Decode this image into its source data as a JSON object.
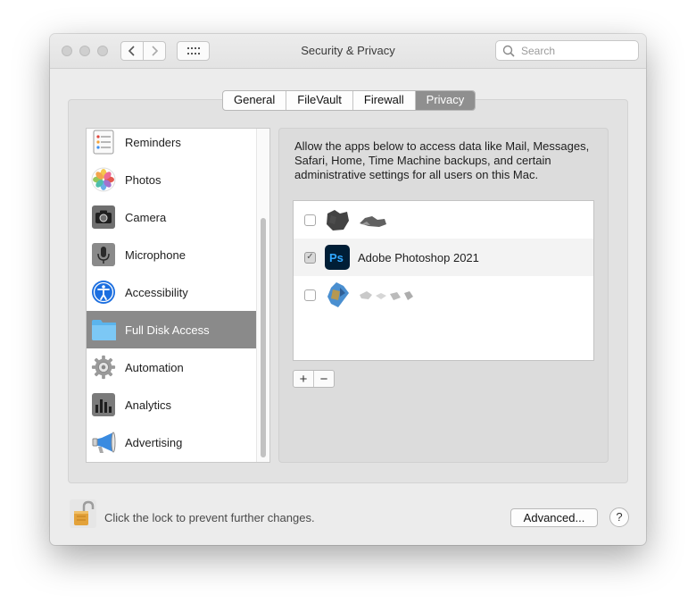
{
  "window": {
    "title": "Security & Privacy"
  },
  "search": {
    "placeholder": "Search"
  },
  "tabs": [
    {
      "label": "General"
    },
    {
      "label": "FileVault"
    },
    {
      "label": "Firewall"
    },
    {
      "label": "Privacy",
      "selected": true
    }
  ],
  "sidebar": {
    "items": [
      {
        "label": "Reminders",
        "icon": "reminders-icon"
      },
      {
        "label": "Photos",
        "icon": "photos-icon"
      },
      {
        "label": "Camera",
        "icon": "camera-icon"
      },
      {
        "label": "Microphone",
        "icon": "microphone-icon"
      },
      {
        "label": "Accessibility",
        "icon": "accessibility-icon"
      },
      {
        "label": "Full Disk Access",
        "icon": "folder-icon",
        "selected": true
      },
      {
        "label": "Automation",
        "icon": "gear-icon"
      },
      {
        "label": "Analytics",
        "icon": "analytics-icon"
      },
      {
        "label": "Advertising",
        "icon": "megaphone-icon"
      }
    ]
  },
  "panel": {
    "description": "Allow the apps below to access data like Mail, Messages, Safari, Home, Time Machine backups, and certain administrative settings for all users on this Mac.",
    "apps": [
      {
        "name": "",
        "checked": false,
        "icon": "redacted-app-icon"
      },
      {
        "name": "Adobe Photoshop 2021",
        "checked": true,
        "icon": "photoshop-icon"
      },
      {
        "name": "",
        "checked": false,
        "icon": "redacted-app-icon"
      }
    ],
    "add_label": "+",
    "remove_label": "−"
  },
  "footer": {
    "lock_text": "Click the lock to prevent further changes.",
    "advanced_label": "Advanced...",
    "help_label": "?"
  },
  "colors": {
    "selection": "#8a8a8a",
    "window_bg": "#ececec",
    "photoshop_blue": "#31a8ff",
    "photoshop_bg": "#001e36"
  }
}
